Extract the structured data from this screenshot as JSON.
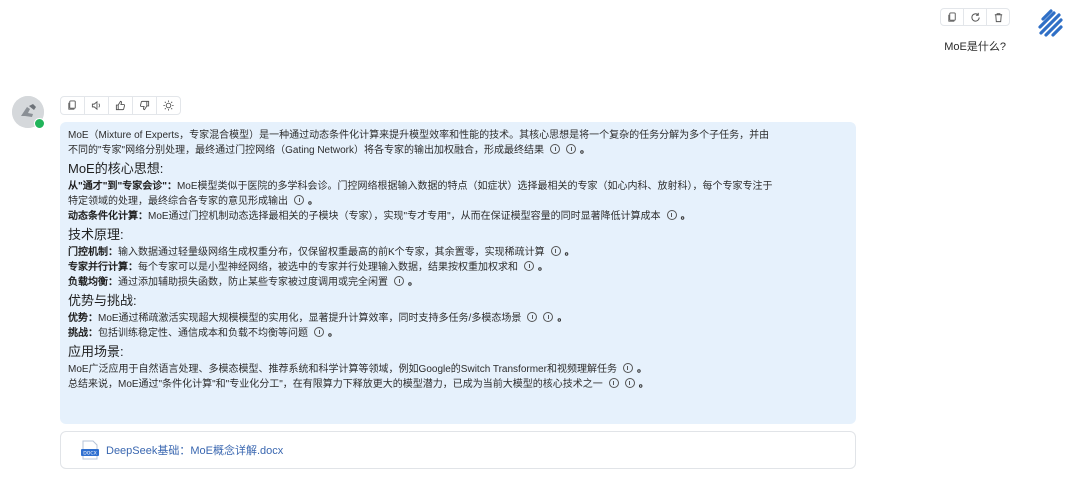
{
  "user": {
    "message": "MoE是什么?",
    "actions": [
      {
        "icon": "copy-icon"
      },
      {
        "icon": "refresh-icon"
      },
      {
        "icon": "trash-icon"
      }
    ],
    "avatar_icon": "striped-logo-icon"
  },
  "bot": {
    "avatar_icon": "robot-avatar-icon",
    "status_color": "#21b45a",
    "toolbar": [
      {
        "icon": "copy-icon"
      },
      {
        "icon": "speaker-icon"
      },
      {
        "icon": "thumbs-up-icon"
      },
      {
        "icon": "thumbs-down-icon"
      },
      {
        "icon": "idea-icon"
      }
    ],
    "answer": {
      "intro_line1": "MoE（Mixture of Experts，专家混合模型）是一种通过动态条件化计算来提升模型效率和性能的技术。其核心思想是将一个复杂的任务分解为多个子任务，并由",
      "intro_line2": "不同的\"专家\"网络分别处理，最终通过门控网络（Gating Network）将各专家的输出加权融合，形成最终结果",
      "sections": [
        {
          "heading": "MoE的核心思想:",
          "items": [
            {
              "label": "从\"通才\"到\"专家会诊\"：",
              "text": "MoE模型类似于医院的多学科会诊。门控网络根据输入数据的特点（如症状）选择最相关的专家（如心内科、放射科），每个专家专注于",
              "text2": "特定领域的处理，最终综合各专家的意见形成输出"
            },
            {
              "label": "动态条件化计算：",
              "text": "MoE通过门控机制动态选择最相关的子模块（专家），实现\"专才专用\"，从而在保证模型容量的同时显著降低计算成本"
            }
          ]
        },
        {
          "heading": "技术原理:",
          "items": [
            {
              "label": "门控机制：",
              "text": "输入数据通过轻量级网络生成权重分布，仅保留权重最高的前K个专家，其余置零，实现稀疏计算"
            },
            {
              "label": "专家并行计算：",
              "text": "每个专家可以是小型神经网络，被选中的专家并行处理输入数据，结果按权重加权求和"
            },
            {
              "label": "负载均衡：",
              "text": "通过添加辅助损失函数，防止某些专家被过度调用或完全闲置"
            }
          ]
        },
        {
          "heading": "优势与挑战:",
          "items": [
            {
              "label": "优势：",
              "text": "MoE通过稀疏激活实现超大规模模型的实用化，显著提升计算效率，同时支持多任务/多模态场景"
            },
            {
              "label": "挑战：",
              "text": "包括训练稳定性、通信成本和负载不均衡等问题"
            }
          ]
        },
        {
          "heading": "应用场景:",
          "items": [
            {
              "label": "",
              "text": "MoE广泛应用于自然语言处理、多模态模型、推荐系统和科学计算等领域，例如Google的Switch Transformer和视频理解任务"
            }
          ]
        }
      ],
      "conclusion": "总结来说，MoE通过\"条件化计算\"和\"专业化分工\"，在有限算力下释放更大的模型潜力，已成为当前大模型的核心技术之一"
    },
    "attachment": {
      "icon": "docx-file-icon",
      "file_type": "DOCX",
      "label": "DeepSeek基础：MoE概念详解.docx"
    }
  }
}
